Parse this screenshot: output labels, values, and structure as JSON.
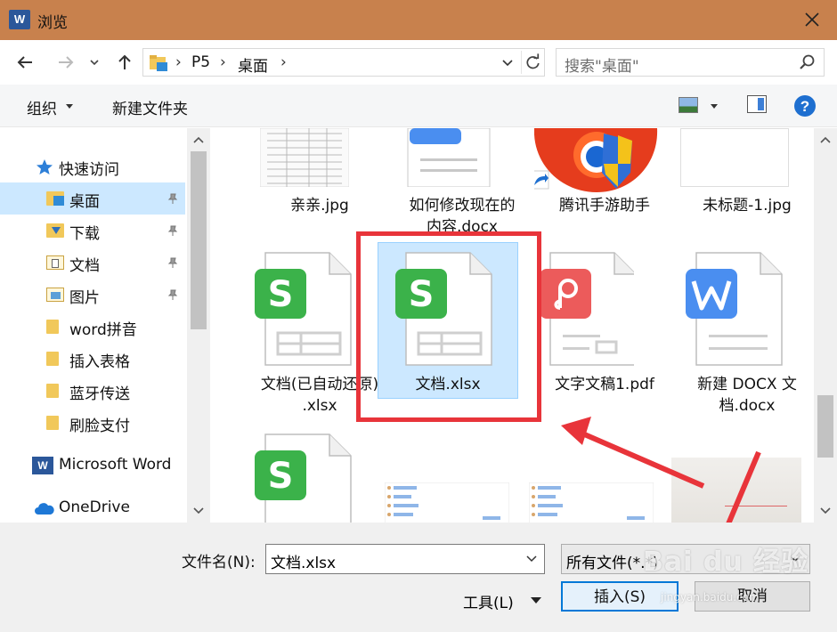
{
  "window": {
    "title": "浏览",
    "app_icon_letter": "W",
    "close_icon": "close-icon"
  },
  "address_bar": {
    "crumbs": [
      "P5",
      "桌面"
    ],
    "search_placeholder": "搜索\"桌面\""
  },
  "toolbar": {
    "organize_label": "组织",
    "new_folder_label": "新建文件夹"
  },
  "sidebar": {
    "quick_access": "快速访问",
    "items": [
      {
        "label": "桌面",
        "pinned": true,
        "selected": true,
        "icon": "desktop-folder-icon"
      },
      {
        "label": "下载",
        "pinned": true,
        "icon": "downloads-folder-icon"
      },
      {
        "label": "文档",
        "pinned": true,
        "icon": "documents-folder-icon"
      },
      {
        "label": "图片",
        "pinned": true,
        "icon": "pictures-folder-icon"
      },
      {
        "label": "word拼音",
        "pinned": false,
        "icon": "folder-icon"
      },
      {
        "label": "插入表格",
        "pinned": false,
        "icon": "folder-icon"
      },
      {
        "label": "蓝牙传送",
        "pinned": false,
        "icon": "folder-icon"
      },
      {
        "label": "刷脸支付",
        "pinned": false,
        "icon": "folder-icon"
      }
    ],
    "microsoft_word": "Microsoft Word",
    "onedrive": "OneDrive"
  },
  "files": {
    "row1": [
      {
        "name": "亲亲.jpg",
        "icon": "image-thumbnail"
      },
      {
        "name": "如何修改现在的内容.docx",
        "line1": "如何修改现在的",
        "line2": "内容.docx",
        "icon": "docx-icon"
      },
      {
        "name": "腾讯手游助手",
        "icon": "shortcut-icon"
      },
      {
        "name": "未标题-1.jpg",
        "icon": "image-thumbnail"
      }
    ],
    "row2": [
      {
        "name": "文档(已自动还原).xlsx",
        "line1": "文档(已自动还原)",
        "line2": ".xlsx",
        "icon": "xlsx-icon"
      },
      {
        "name": "文档.xlsx",
        "icon": "xlsx-icon",
        "selected": true
      },
      {
        "name": "文字文稿1.pdf",
        "icon": "pdf-icon"
      },
      {
        "name": "新建 DOCX 文档.docx",
        "line1": "新建 DOCX 文",
        "line2": "档.docx",
        "icon": "docx-icon"
      }
    ]
  },
  "footer": {
    "filename_label": "文件名(N):",
    "filename_value": "文档.xlsx",
    "filetype_value": "所有文件(*.*)",
    "tools_label": "工具(L)",
    "insert_label": "插入(S)",
    "cancel_label": "取消"
  },
  "watermark": {
    "brand": "Bai du 经验",
    "url": "jingyan.baidu.com"
  },
  "colors": {
    "titlebar": "#c8814d",
    "selection": "#cce8ff",
    "annotation_red": "#e8343a",
    "xlsx_green": "#3bb24a",
    "docx_blue": "#4a8ef0",
    "pdf_red": "#ec5b5b"
  }
}
